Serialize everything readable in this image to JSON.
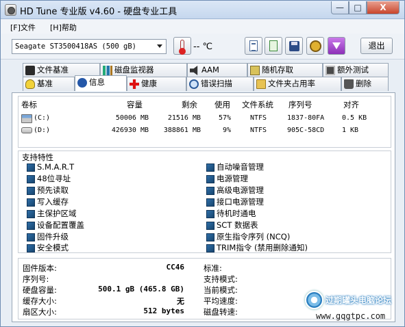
{
  "window": {
    "title": "HD Tune 专业版 v4.60 - 硬盘专业工具",
    "min_label": "—",
    "max_label": "□",
    "close_label": "X"
  },
  "menu": {
    "file": "[F]文件",
    "help": "[H]帮助"
  },
  "toolbar": {
    "drive": "Seagate ST3500418AS      (500 gB)",
    "temperature": "-- ℃",
    "exit_label": "退出"
  },
  "tabs": {
    "row1": [
      "文件基准",
      "磁盘监视器",
      "AAM",
      "随机存取",
      "额外测试"
    ],
    "row2": [
      "基准",
      "信息",
      "健康",
      "错误扫描",
      "文件夹占用率",
      "删除"
    ],
    "active": "信息"
  },
  "volumes": {
    "headers": [
      "卷标",
      "容量",
      "剩余",
      "使用",
      "文件系统",
      "序列号",
      "对齐"
    ],
    "rows": [
      {
        "label": "(C:)",
        "capacity": "50006 MB",
        "free": "21516 MB",
        "used": "57%",
        "fs": "NTFS",
        "serial": "1837-80FA",
        "align": "0.5 KB"
      },
      {
        "label": "(D:)",
        "capacity": "426930 MB",
        "free": "388861 MB",
        "used": "9%",
        "fs": "NTFS",
        "serial": "905C-58CD",
        "align": "1 KB"
      }
    ]
  },
  "features": {
    "title": "支持特性",
    "left": [
      "S.M.A.R.T",
      "48位寻址",
      "预先读取",
      "写入缓存",
      "主保护区域",
      "设备配置覆盖",
      "固件升级",
      "安全模式"
    ],
    "right": [
      "自动噪音管理",
      "电源管理",
      "高级电源管理",
      "接口电源管理",
      "待机时通电",
      "SCT 数据表",
      "原生指令序列 (NCQ)",
      "TRIM指令 (禁用删除通知)"
    ]
  },
  "details": {
    "left": [
      {
        "label": "固件版本:",
        "value": "CC46"
      },
      {
        "label": "序列号:",
        "value": ""
      },
      {
        "label": "硬盘容量:",
        "value": "500.1 gB (465.8 GB)"
      },
      {
        "label": "缓存大小:",
        "value": "无"
      },
      {
        "label": "扇区大小:",
        "value": "512 bytes"
      }
    ],
    "right": [
      {
        "label": "标准:",
        "value": ""
      },
      {
        "label": "支持模式:",
        "value": ""
      },
      {
        "label": "当前模式:",
        "value": ""
      },
      {
        "label": "平均速度:",
        "value": ""
      },
      {
        "label": "磁盘转速:",
        "value": ""
      }
    ]
  },
  "watermark": {
    "text": "过期罐头电脑论坛",
    "url": "www.gqgtpc.com"
  }
}
